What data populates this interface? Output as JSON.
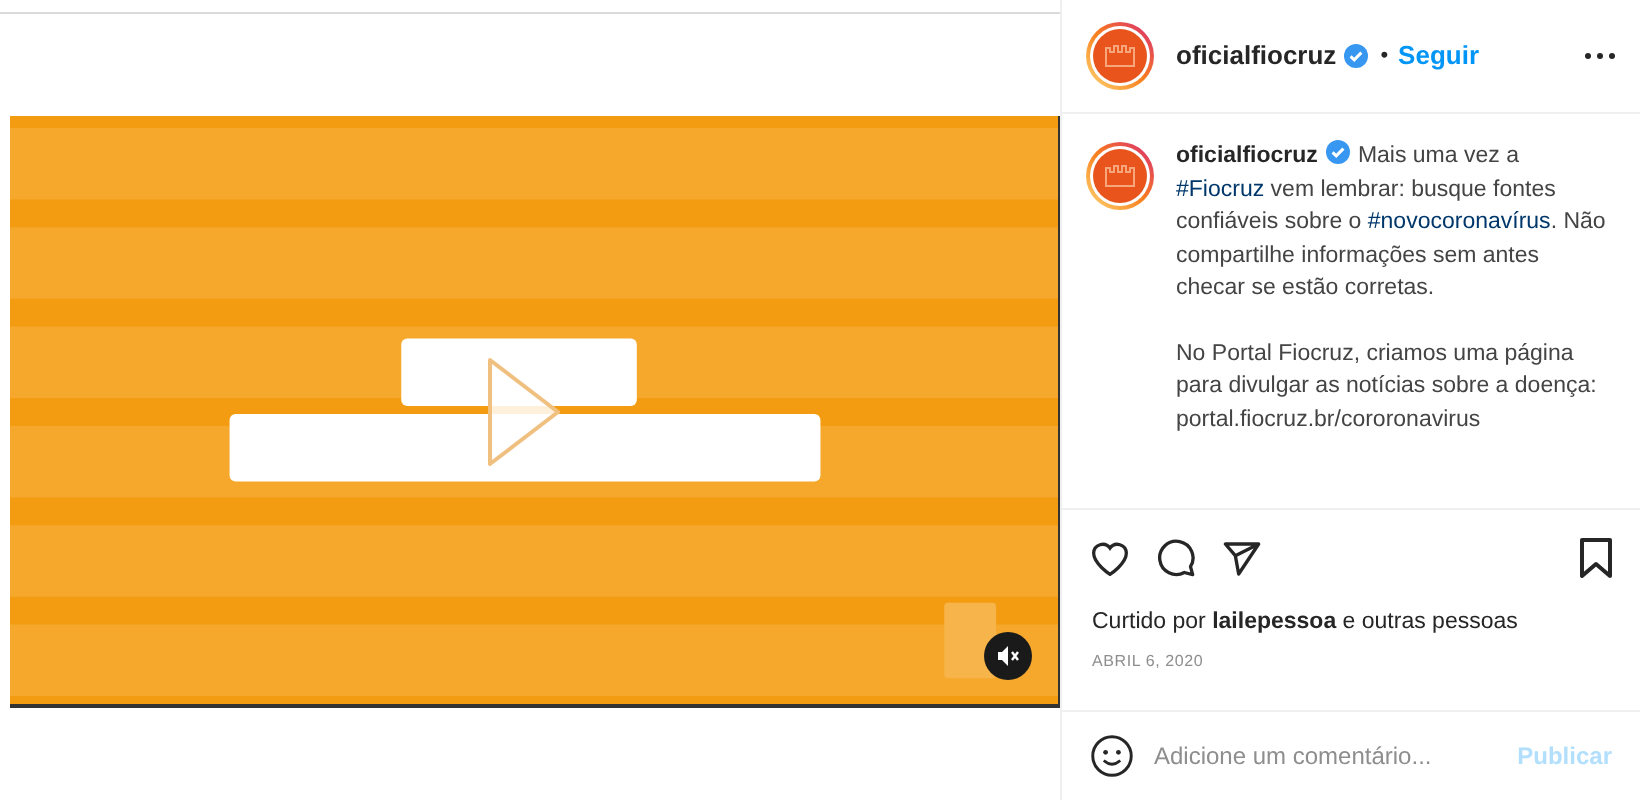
{
  "video": {
    "kind": "picture",
    "muted": true
  },
  "header": {
    "username": "oficialfiocruz",
    "verified": true,
    "separator": "•",
    "follow": "Seguir"
  },
  "caption": {
    "username": "oficialfiocruz",
    "verified": true,
    "paragraphs": [
      [
        {
          "kind": "text",
          "text": "Mais uma vez a "
        },
        {
          "kind": "hashtag",
          "text": "#Fiocruz"
        },
        {
          "kind": "text",
          "text": " vem lembrar: busque fontes confiáveis sobre o "
        },
        {
          "kind": "hashtag",
          "text": "#novocoronavírus"
        },
        {
          "kind": "text",
          "text": ". Não compartilhe informações sem antes checar se estão corretas."
        }
      ],
      [
        {
          "kind": "text",
          "text": "No Portal Fiocruz, criamos uma página para divulgar as notícias sobre a doença: portal.fiocruz.br/cororonavirus"
        }
      ]
    ]
  },
  "actions": {
    "liked": false,
    "saved": false
  },
  "likes": "Curtido por **lailepessoa** e outras pessoas",
  "date": "ABRIL 6, 2020",
  "comment": {
    "placeholder": "Adicione um comentário...",
    "submit": "Publicar",
    "submit_disabled": true
  }
}
